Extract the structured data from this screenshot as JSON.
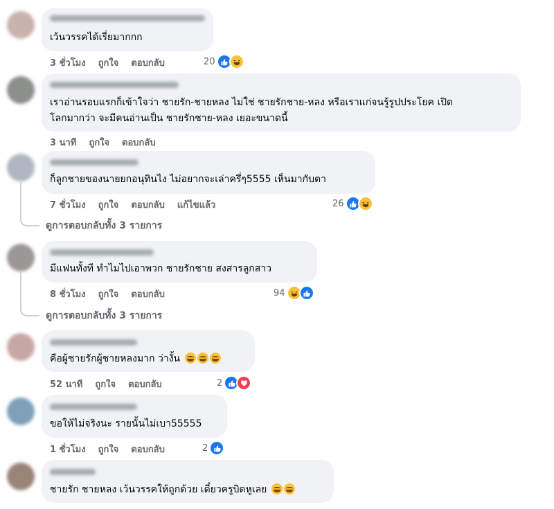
{
  "colors": {
    "like": "#1877f2",
    "haha": "#f7c23b",
    "love": "#f33e58",
    "bubble": "#f0f2f5",
    "meta": "#65676b"
  },
  "comments": [
    {
      "text_lines": [
        "เว้นวรรคได้เรี่ยมากกก"
      ],
      "time": "3 ชั่วโมง",
      "like": "ถูกใจ",
      "reply": "ตอบกลับ",
      "edited": "",
      "reaction_count": "20",
      "reactions": [
        "like-icon",
        "haha-icon"
      ]
    },
    {
      "text_lines": [
        "เราอ่านรอบแรกก็เข้าใจว่า ชายรัก-ชายหลง ไม่ใช่ ชายรักชาย-หลง หรือเราแก่จนรู้รูปประโยค เปิด",
        "โลกมากว่า จะมีคนอ่านเป็น ชายรักชาย-หลง เยอะขนาดนี้"
      ],
      "time": "3 นาที",
      "like": "ถูกใจ",
      "reply": "ตอบกลับ",
      "edited": "",
      "reaction_count": "",
      "reactions": []
    },
    {
      "text_lines": [
        "ก็ลูกชายของนายยกอนุทินไง ไม่อยากจะเล่าครึ่ๆ5555 เห็นมากับตา"
      ],
      "time": "7 ชั่วโมง",
      "like": "ถูกใจ",
      "reply": "ตอบกลับ",
      "edited": "แก้ไขแล้ว",
      "reaction_count": "26",
      "reactions": [
        "like-icon",
        "haha-icon"
      ],
      "replies": "ดูการตอบกลับทั้ง 3 รายการ"
    },
    {
      "text_lines": [
        "มีแฟนทั้งที ทำไมไปเอาพวก ชายรักชาย สงสารลูกสาว"
      ],
      "time": "8 ชั่วโมง",
      "like": "ถูกใจ",
      "reply": "ตอบกลับ",
      "edited": "",
      "reaction_count": "94",
      "reactions": [
        "haha-icon",
        "like-icon"
      ],
      "replies": "ดูการตอบกลับทั้ง 3 รายการ"
    },
    {
      "text_lines": [
        "คือผู้ชายรักผู้ชายหลงมาก ว่างั้น"
      ],
      "time": "52 นาที",
      "like": "ถูกใจ",
      "reply": "ตอบกลับ",
      "edited": "",
      "reaction_count": "2",
      "reactions": [
        "like-icon",
        "love-icon"
      ]
    },
    {
      "text_lines": [
        "ขอให้ไม่จริงนะ รายนั้นไม่เบา55555"
      ],
      "time": "1 ชั่วโมง",
      "like": "ถูกใจ",
      "reply": "ตอบกลับ",
      "edited": "",
      "reaction_count": "2",
      "reactions": [
        "like-icon"
      ]
    },
    {
      "text_lines": [
        "ชายรัก ชายหลง เว้นวรรคให้ถูกด้วย เดี๋ยวครูบิดหูเลย"
      ],
      "time": "",
      "like": "",
      "reply": "",
      "edited": "",
      "reaction_count": "",
      "reactions": []
    }
  ]
}
